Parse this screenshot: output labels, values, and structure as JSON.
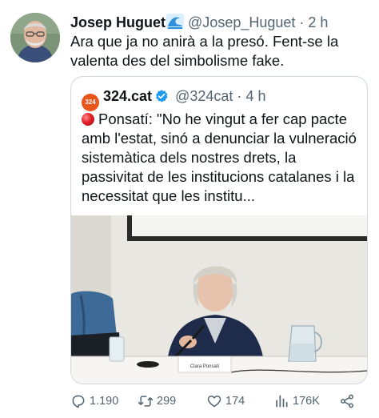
{
  "tweet": {
    "author_name": "Josep Huguet",
    "author_handle": "@Josep_Huguet",
    "separator": "·",
    "time": "2 h",
    "text": "Ara que ja no anirà a la presó. Fent-se la valenta des del simbolisme fake."
  },
  "quoted": {
    "logo_text": "324",
    "author_name": "324.cat",
    "author_handle": "@324cat",
    "separator": "·",
    "time": "4 h",
    "text": "Ponsatí: \"No he vingut a fer cap pacte amb l'estat, sinó a denunciar la vulneració sistemàtica dels nostres drets, la passivitat de les institucions catalanes i la necessitat que les institu...",
    "nameplate": "Clara Ponsatí"
  },
  "actions": {
    "replies": "1.190",
    "retweets": "299",
    "likes": "174",
    "views": "176K"
  },
  "icons": [
    "reply-icon",
    "retweet-icon",
    "like-icon",
    "views-icon",
    "share-icon",
    "verified-icon",
    "water-wave-icon"
  ],
  "colors": {
    "text": "#0f1419",
    "muted": "#536471",
    "verified": "#1d9bf0",
    "border": "#cfd9de",
    "logo": "#e8561c"
  }
}
